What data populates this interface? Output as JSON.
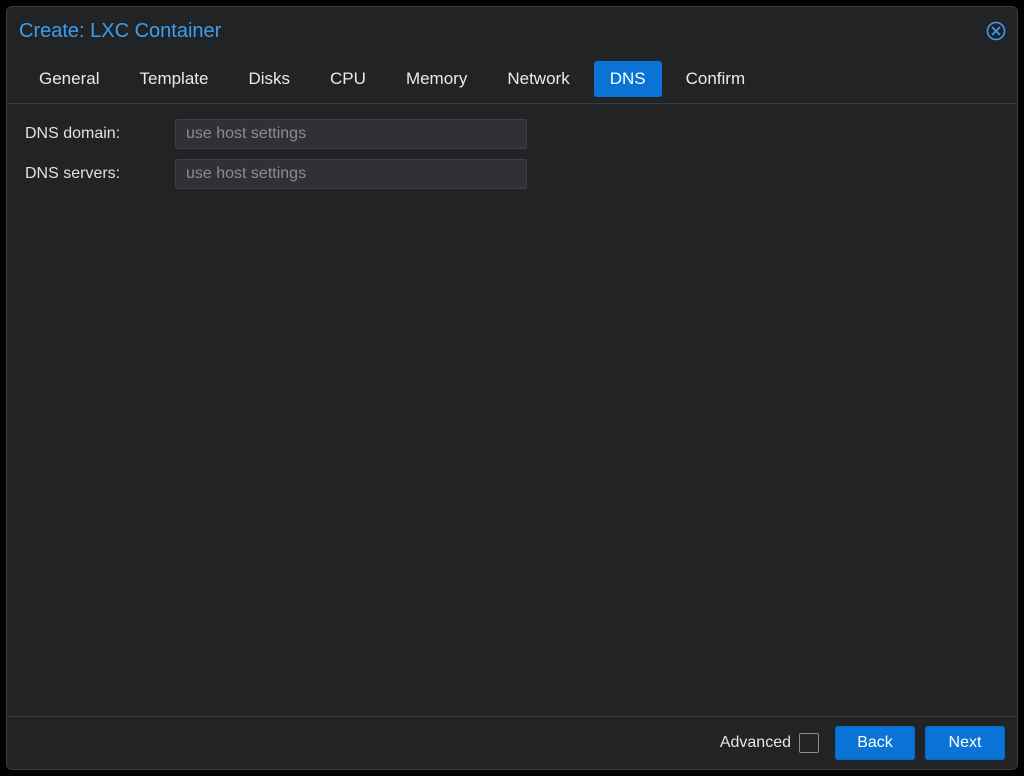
{
  "window": {
    "title": "Create: LXC Container"
  },
  "tabs": [
    {
      "id": "general",
      "label": "General",
      "active": false
    },
    {
      "id": "template",
      "label": "Template",
      "active": false
    },
    {
      "id": "disks",
      "label": "Disks",
      "active": false
    },
    {
      "id": "cpu",
      "label": "CPU",
      "active": false
    },
    {
      "id": "memory",
      "label": "Memory",
      "active": false
    },
    {
      "id": "network",
      "label": "Network",
      "active": false
    },
    {
      "id": "dns",
      "label": "DNS",
      "active": true
    },
    {
      "id": "confirm",
      "label": "Confirm",
      "active": false
    }
  ],
  "form": {
    "dns_domain": {
      "label": "DNS domain:",
      "value": "",
      "placeholder": "use host settings"
    },
    "dns_servers": {
      "label": "DNS servers:",
      "value": "",
      "placeholder": "use host settings"
    }
  },
  "footer": {
    "advanced_label": "Advanced",
    "advanced_checked": false,
    "back_label": "Back",
    "next_label": "Next"
  },
  "colors": {
    "accent": "#0a74d6",
    "link": "#3b9ef3",
    "bg": "#222325",
    "border": "#3a3c3f"
  }
}
